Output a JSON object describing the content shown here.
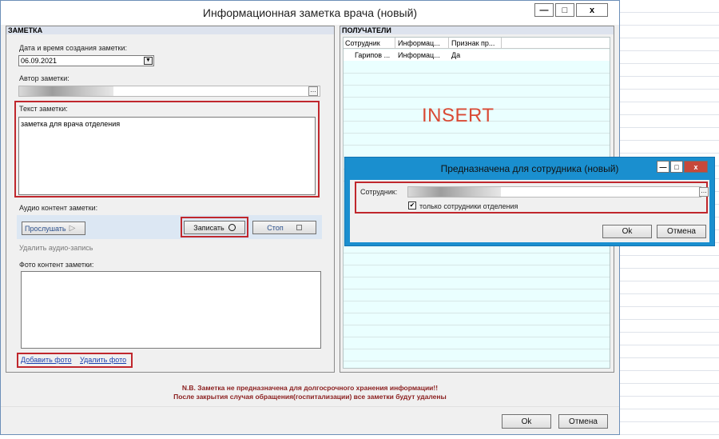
{
  "window": {
    "title": "Информационная заметка врача (новый)",
    "min": "—",
    "max": "□",
    "close": "x"
  },
  "note_group": {
    "header": "ЗАМЕТКА",
    "date_label": "Дата и время создания заметки:",
    "date_value": "06.09.2021",
    "author_label": "Автор заметки:",
    "text_label": "Текст заметки:",
    "text_value": "заметка для врача отделения",
    "audio_label": "Аудио контент заметки:",
    "listen_label": "Прослушать",
    "record_label": "Записать",
    "stop_label": "Стоп",
    "delete_audio": "Удалить аудио-запись",
    "photo_label": "Фото контент заметки:",
    "add_photo": "Добавить фото",
    "delete_photo": "Удалить фото"
  },
  "recipients": {
    "header": "ПОЛУЧАТЕЛИ",
    "columns": [
      "Сотрудник",
      "Информац...",
      "Признак пр..."
    ],
    "rows": [
      [
        "Гарипов ...",
        "Информац...",
        "Да"
      ]
    ],
    "insert_text": "INSERT"
  },
  "footer": {
    "note_line1": "N.B. Заметка не предназначена для долгосрочного хранения информации!!",
    "note_line2": "После закрытия случая обращения(госпитализации) все заметки будут удалены",
    "ok": "Ok",
    "cancel": "Отмена"
  },
  "dialog": {
    "title": "Предназначена для сотрудника (новый)",
    "employee_label": "Сотрудник:",
    "checkbox_label": "только сотрудники отделения",
    "checkbox_checked": true,
    "ok": "Ok",
    "cancel": "Отмена"
  },
  "colors": {
    "highlight": "#c0272d",
    "insert": "#d94a35",
    "dialog_frame": "#1a8fcf",
    "grid_bg": "#eaffff",
    "note": "#8a1e1e"
  }
}
